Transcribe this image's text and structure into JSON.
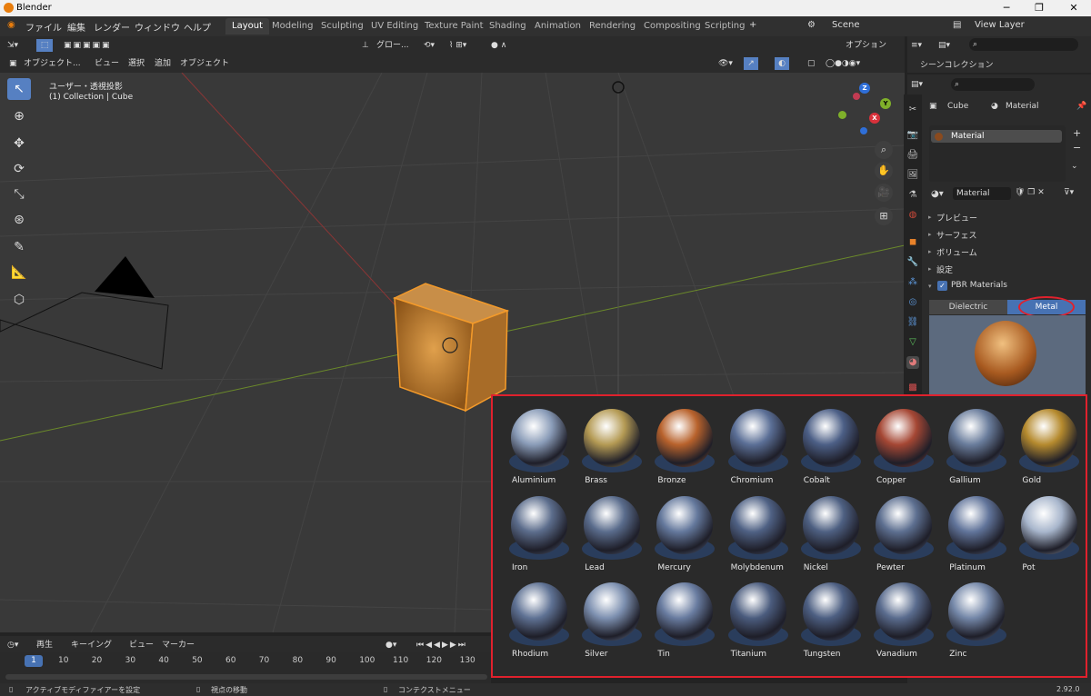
{
  "window": {
    "title": "Blender",
    "version": "2.92.0"
  },
  "menu": [
    "ファイル",
    "編集",
    "レンダー",
    "ウィンドウ",
    "ヘルプ"
  ],
  "workspaces": [
    {
      "label": "Layout",
      "active": true
    },
    {
      "label": "Modeling"
    },
    {
      "label": "Sculpting"
    },
    {
      "label": "UV Editing"
    },
    {
      "label": "Texture Paint"
    },
    {
      "label": "Shading"
    },
    {
      "label": "Animation"
    },
    {
      "label": "Rendering"
    },
    {
      "label": "Compositing"
    },
    {
      "label": "Scripting"
    }
  ],
  "scene": {
    "label": "Scene",
    "view_layer": "View Layer"
  },
  "toolheader": {
    "transform": "グロー...",
    "options": "オプション"
  },
  "viewport_header": {
    "mode": "オブジェクト...",
    "view": "ビュー",
    "select": "選択",
    "add": "追加",
    "object": "オブジェクト"
  },
  "viewport": {
    "projection": "ユーザー・透視投影",
    "collection": "(1) Collection | Cube"
  },
  "gizmo": {
    "z": "Z",
    "y": "Y",
    "x": "X"
  },
  "outliner": {
    "title": "シーンコレクション"
  },
  "properties": {
    "object": "Cube",
    "material_tab": "Material",
    "slot": "Material",
    "material_name": "Material",
    "panels": [
      "プレビュー",
      "サーフェス",
      "ボリューム",
      "設定"
    ],
    "addon_panel": "PBR Materials",
    "tabs": [
      {
        "label": "Dielectric",
        "active": false
      },
      {
        "label": "Metal",
        "active": true
      }
    ]
  },
  "materials": [
    {
      "name": "Aluminium",
      "color": "#8a9cb8"
    },
    {
      "name": "Brass",
      "color": "#b49a54"
    },
    {
      "name": "Bronze",
      "color": "#b8622c"
    },
    {
      "name": "Chromium",
      "color": "#5b6f96"
    },
    {
      "name": "Cobalt",
      "color": "#4c5f86"
    },
    {
      "name": "Copper",
      "color": "#a54734"
    },
    {
      "name": "Gallium",
      "color": "#6a7d9c"
    },
    {
      "name": "Gold",
      "color": "#b58a2e"
    },
    {
      "name": "Iron",
      "color": "#5c6d8c"
    },
    {
      "name": "Lead",
      "color": "#5a6c8c"
    },
    {
      "name": "Mercury",
      "color": "#64789c"
    },
    {
      "name": "Molybdenum",
      "color": "#4f6184"
    },
    {
      "name": "Nickel",
      "color": "#4e6082"
    },
    {
      "name": "Pewter",
      "color": "#5d6f90"
    },
    {
      "name": "Platinum",
      "color": "#61749a"
    },
    {
      "name": "Pot",
      "color": "#a8b6cc"
    },
    {
      "name": "Rhodium",
      "color": "#5f7294"
    },
    {
      "name": "Silver",
      "color": "#7d90b0"
    },
    {
      "name": "Tin",
      "color": "#697ca0"
    },
    {
      "name": "Titanium",
      "color": "#4b5c7e"
    },
    {
      "name": "Tungsten",
      "color": "#4d5f82"
    },
    {
      "name": "Vanadium",
      "color": "#5a6c8e"
    },
    {
      "name": "Zinc",
      "color": "#7487a8"
    }
  ],
  "timeline": {
    "playback": "再生",
    "keying": "キーイング",
    "view": "ビュー",
    "marker": "マーカー",
    "current_frame": "1",
    "frames": [
      "10",
      "20",
      "30",
      "40",
      "50",
      "60",
      "70",
      "80",
      "90",
      "100",
      "110",
      "120",
      "130"
    ]
  },
  "status": {
    "left": "アクティブモディファイアーを設定",
    "mid": "視点の移動",
    "right": "コンテクストメニュー"
  }
}
